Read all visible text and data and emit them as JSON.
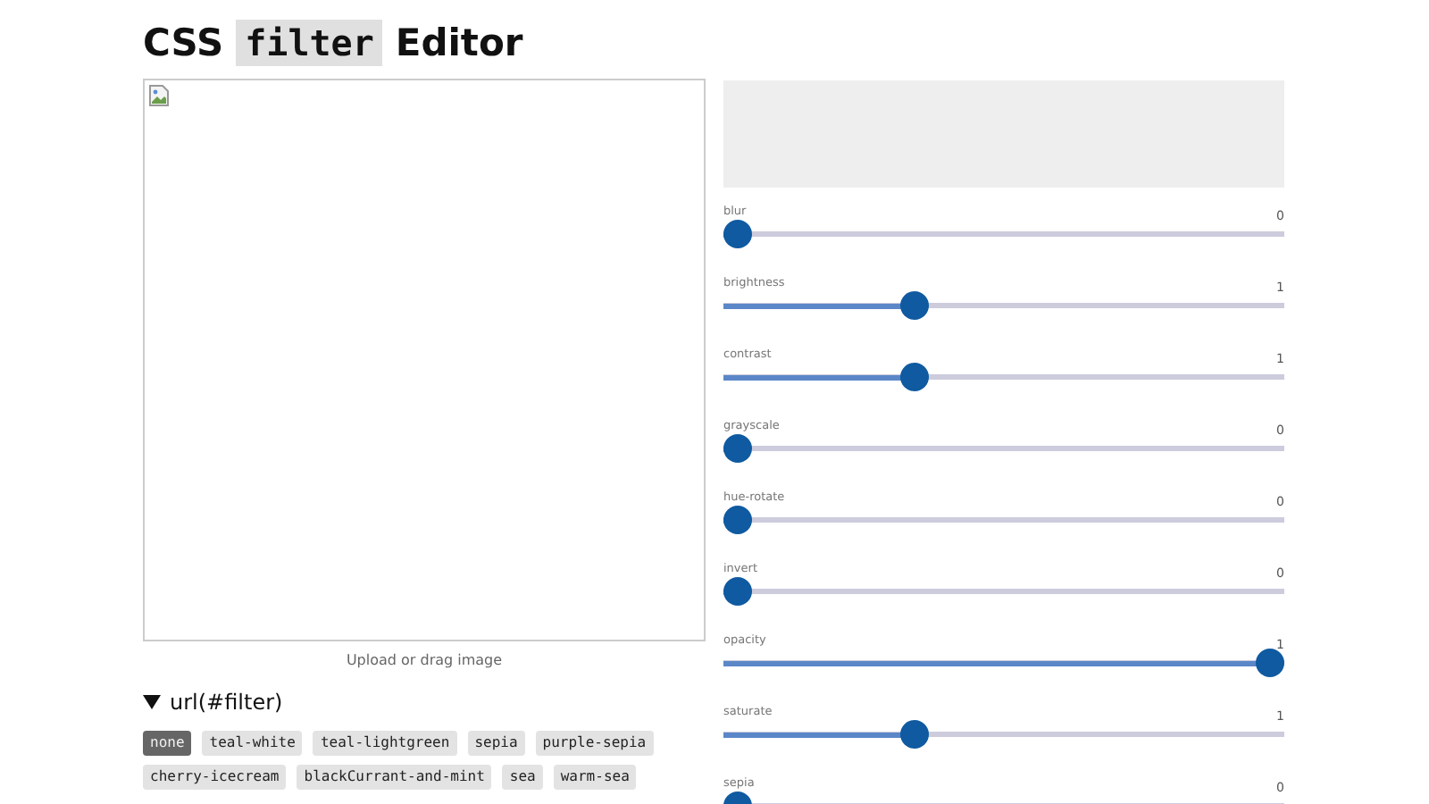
{
  "heading": {
    "before": "CSS",
    "code": "filter",
    "after": "Editor"
  },
  "image_panel": {
    "caption": "Upload or drag image"
  },
  "filter_section": {
    "summary": "url(#filter)",
    "expanded": true,
    "presets": [
      {
        "label": "none",
        "selected": true
      },
      {
        "label": "teal-white",
        "selected": false
      },
      {
        "label": "teal-lightgreen",
        "selected": false
      },
      {
        "label": "sepia",
        "selected": false
      },
      {
        "label": "purple-sepia",
        "selected": false
      },
      {
        "label": "cherry-icecream",
        "selected": false
      },
      {
        "label": "blackCurrant-and-mint",
        "selected": false
      },
      {
        "label": "sea",
        "selected": false
      },
      {
        "label": "warm-sea",
        "selected": false
      }
    ]
  },
  "sliders": [
    {
      "name": "blur",
      "value": "0",
      "level": 0
    },
    {
      "name": "brightness",
      "value": "1",
      "level": 0.333
    },
    {
      "name": "contrast",
      "value": "1",
      "level": 0.333
    },
    {
      "name": "grayscale",
      "value": "0",
      "level": 0
    },
    {
      "name": "hue-rotate",
      "value": "0",
      "level": 0
    },
    {
      "name": "invert",
      "value": "0",
      "level": 0
    },
    {
      "name": "opacity",
      "value": "1",
      "level": 1
    },
    {
      "name": "saturate",
      "value": "1",
      "level": 0.333
    },
    {
      "name": "sepia",
      "value": "0",
      "level": 0
    }
  ]
}
